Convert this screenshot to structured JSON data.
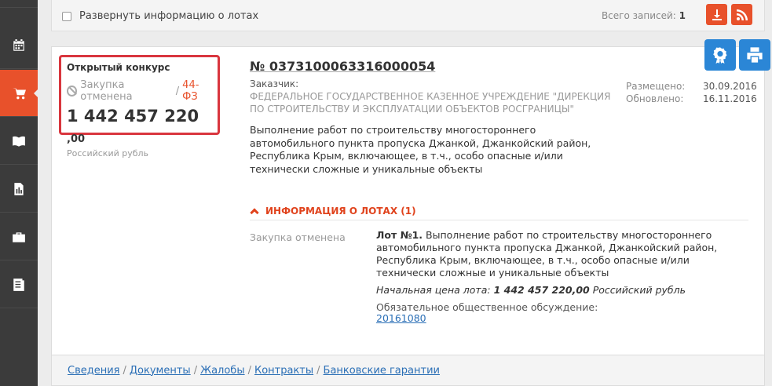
{
  "topbar": {
    "expand_label": "Развернуть информацию о лотах",
    "total_label": "Всего записей:",
    "total_count": "1"
  },
  "sidebar": {
    "items": [
      {
        "icon": "home-icon"
      },
      {
        "icon": "calendar-icon"
      },
      {
        "icon": "cart-icon",
        "active": true
      },
      {
        "icon": "book-icon"
      },
      {
        "icon": "report-icon"
      },
      {
        "icon": "briefcase-icon"
      },
      {
        "icon": "document-icon"
      }
    ]
  },
  "card": {
    "procedure_type": "Открытый конкурс",
    "status": "Закупка отменена",
    "status_separator": "/",
    "law": "44-ФЗ",
    "price_main": "1 442 457 220",
    "price_cents": ",00",
    "currency": "Российский рубль",
    "number": "№ 0373100063316000054",
    "customer_label": "Заказчик:",
    "customer_name": "ФЕДЕРАЛЬНОЕ ГОСУДАРСТВЕННОЕ КАЗЕННОЕ УЧРЕЖДЕНИЕ \"ДИРЕКЦИЯ ПО СТРОИТЕЛЬСТВУ И ЭКСПЛУАТАЦИИ ОБЪЕКТОВ РОСГРАНИЦЫ\"",
    "posted_label": "Размещено:",
    "posted_value": "30.09.2016",
    "updated_label": "Обновлено:",
    "updated_value": "16.11.2016",
    "description": "Выполнение работ по строительству многостороннего автомобильного пункта пропуска Джанкой, Джанкойский район, Республика Крым, включающее,  в т.ч., особо опасные и/или технически сложные и уникальные объекты",
    "lots_header": "ИНФОРМАЦИЯ О ЛОТАХ (1)",
    "lot": {
      "status": "Закупка отменена",
      "title_prefix": "Лот №1.",
      "title": "Выполнение работ по строительству многостороннего автомобильного пункта пропуска Джанкой, Джанкойский район, Республика Крым, включающее,  в т.ч., особо опасные и/или технически сложные и уникальные объекты",
      "price_label": "Начальная цена лота:",
      "price_value": "1 442 457 220,00",
      "price_currency": "Российский рубль",
      "discussion_label": "Обязательное общественное обсуждение:",
      "discussion_link": "20161080"
    }
  },
  "bottom_links": {
    "info": "Сведения",
    "docs": "Документы",
    "complaints": "Жалобы",
    "contracts": "Контракты",
    "guarantees": "Банковские гарантии",
    "separator": "/"
  },
  "colors": {
    "accent": "#e8512b",
    "highlight_border": "#d9363e",
    "blue": "#2b86d6",
    "sidebar": "#3b3b3b"
  }
}
